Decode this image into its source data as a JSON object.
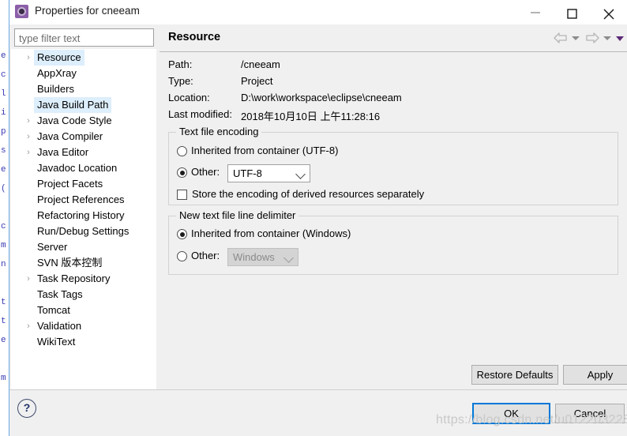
{
  "window": {
    "title": "Properties for cneeam",
    "icon": "eclipse-properties-icon",
    "minimize_label": "Minimize",
    "maximize_label": "Maximize",
    "close_label": "Close"
  },
  "filter": {
    "placeholder": "type filter text",
    "value": ""
  },
  "tree": {
    "items": [
      {
        "label": "Resource",
        "expandable": true,
        "selected": true
      },
      {
        "label": "AppXray",
        "expandable": false,
        "selected": false
      },
      {
        "label": "Builders",
        "expandable": false,
        "selected": false
      },
      {
        "label": "Java Build Path",
        "expandable": false,
        "selected": true
      },
      {
        "label": "Java Code Style",
        "expandable": true,
        "selected": false
      },
      {
        "label": "Java Compiler",
        "expandable": true,
        "selected": false
      },
      {
        "label": "Java Editor",
        "expandable": true,
        "selected": false
      },
      {
        "label": "Javadoc Location",
        "expandable": false,
        "selected": false
      },
      {
        "label": "Project Facets",
        "expandable": false,
        "selected": false
      },
      {
        "label": "Project References",
        "expandable": false,
        "selected": false
      },
      {
        "label": "Refactoring History",
        "expandable": false,
        "selected": false
      },
      {
        "label": "Run/Debug Settings",
        "expandable": false,
        "selected": false
      },
      {
        "label": "Server",
        "expandable": false,
        "selected": false
      },
      {
        "label": "SVN 版本控制",
        "expandable": false,
        "selected": false
      },
      {
        "label": "Task Repository",
        "expandable": true,
        "selected": false
      },
      {
        "label": "Task Tags",
        "expandable": false,
        "selected": false
      },
      {
        "label": "Tomcat",
        "expandable": false,
        "selected": false
      },
      {
        "label": "Validation",
        "expandable": true,
        "selected": false
      },
      {
        "label": "WikiText",
        "expandable": false,
        "selected": false
      }
    ]
  },
  "page": {
    "title": "Resource",
    "nav": {
      "back": "back-arrow",
      "back_caret": "chevron-down-icon",
      "forward": "forward-arrow",
      "forward_caret": "chevron-down-icon",
      "menu_caret": "view-menu-caret"
    },
    "info": [
      {
        "label": "Path:",
        "value": "/cneeam"
      },
      {
        "label": "Type:",
        "value": "Project"
      },
      {
        "label": "Location:",
        "value": "D:\\work\\workspace\\eclipse\\cneeam"
      },
      {
        "label": "Last modified:",
        "value": "2018年10月10日 上午11:28:16"
      }
    ],
    "encoding_group": {
      "title": "Text file encoding",
      "inherited_label": "Inherited from container (UTF-8)",
      "inherited_selected": false,
      "other_label": "Other:",
      "other_selected": true,
      "other_value": "UTF-8",
      "store_derived_label": "Store the encoding of derived resources separately",
      "store_derived_checked": false
    },
    "delimiter_group": {
      "title": "New text file line delimiter",
      "inherited_label": "Inherited from container (Windows)",
      "inherited_selected": true,
      "other_label": "Other:",
      "other_selected": false,
      "other_value": "Windows",
      "other_disabled": true
    }
  },
  "buttons": {
    "restore_defaults": "Restore Defaults",
    "apply": "Apply",
    "ok": "OK",
    "cancel": "Cancel",
    "help": "?"
  },
  "watermark": "https://blog.csdn.net/u012203228",
  "background_fragments": [
    "e",
    "c",
    "l",
    "i",
    "p",
    "s",
    "e",
    "(",
    "",
    "c",
    "m",
    "n",
    "",
    "t",
    "t",
    "e",
    "",
    "m"
  ],
  "colors": {
    "accent": "#0078d7",
    "dialog_bg": "#f0f0f0",
    "tree_selection": "#ddeefc",
    "title_icon": "#8b5ea8"
  }
}
